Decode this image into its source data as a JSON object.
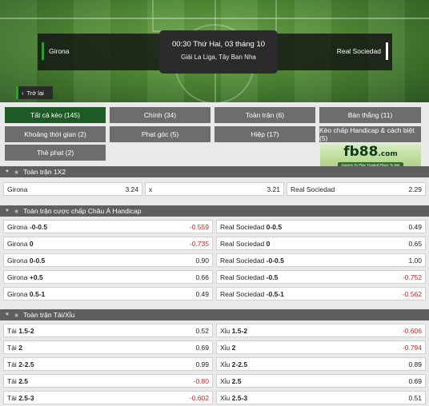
{
  "match": {
    "home": "Girona",
    "away": "Real Sociedad",
    "datetime": "00:30 Thứ Hai, 03 tháng 10",
    "league": "Giải La Liga, Tây Ban Nha",
    "back_label": "Trở lại"
  },
  "filters": [
    {
      "label": "Tất cả kèo (145)",
      "active": true
    },
    {
      "label": "Chính (34)"
    },
    {
      "label": "Toàn trận (6)"
    },
    {
      "label": "Bàn thắng (11)"
    },
    {
      "label": "Khoảng thời gian (2)"
    },
    {
      "label": "Phạt góc (5)"
    },
    {
      "label": "Hiệp (17)"
    },
    {
      "label": "Kèo chấp Handicap & cách biệt (5)"
    },
    {
      "label": "Thẻ phạt (2)"
    }
  ],
  "ad": {
    "logo_main": "fb88",
    "logo_suffix": ".com",
    "tagline": "Games To Play  Trusted Place To Bet"
  },
  "section_1x2": {
    "title": "Toàn trận 1X2",
    "cells": [
      {
        "label": "Girona",
        "value": "3.24"
      },
      {
        "label": "x",
        "value": "3.21"
      },
      {
        "label": "Real Sociedad",
        "value": "2.29"
      }
    ]
  },
  "section_handicap": {
    "title": "Toàn trận cược chấp Châu Á Handicap",
    "rows": [
      {
        "left_team": "Girona",
        "left_line": "-0-0.5",
        "left_value": "-0.559",
        "right_team": "Real Sociedad",
        "right_line": "0-0.5",
        "right_value": "0.49"
      },
      {
        "left_team": "Girona",
        "left_line": "0",
        "left_value": "-0.735",
        "right_team": "Real Sociedad",
        "right_line": "0",
        "right_value": "0.65"
      },
      {
        "left_team": "Girona",
        "left_line": "0-0.5",
        "left_value": "0.90",
        "right_team": "Real Sociedad",
        "right_line": "-0-0.5",
        "right_value": "1.00"
      },
      {
        "left_team": "Girona",
        "left_line": "+0.5",
        "left_value": "0.66",
        "right_team": "Real Sociedad",
        "right_line": "-0.5",
        "right_value": "-0.752"
      },
      {
        "left_team": "Girona",
        "left_line": "0.5-1",
        "left_value": "0.49",
        "right_team": "Real Sociedad",
        "right_line": "-0.5-1",
        "right_value": "-0.562"
      }
    ]
  },
  "section_ou": {
    "title": "Toàn trận Tài/Xỉu",
    "rows": [
      {
        "left_label": "Tài",
        "left_line": "1.5-2",
        "left_value": "0.52",
        "right_label": "Xỉu",
        "right_line": "1.5-2",
        "right_value": "-0.606"
      },
      {
        "left_label": "Tài",
        "left_line": "2",
        "left_value": "0.69",
        "right_label": "Xỉu",
        "right_line": "2",
        "right_value": "-0.794"
      },
      {
        "left_label": "Tài",
        "left_line": "2-2.5",
        "left_value": "0.99",
        "right_label": "Xỉu",
        "right_line": "2-2.5",
        "right_value": "0.89"
      },
      {
        "left_label": "Tài",
        "left_line": "2.5",
        "left_value": "-0.80",
        "right_label": "Xỉu",
        "right_line": "2.5",
        "right_value": "0.69"
      },
      {
        "left_label": "Tài",
        "left_line": "2.5-3",
        "left_value": "-0.602",
        "right_label": "Xỉu",
        "right_line": "2.5-3",
        "right_value": "0.51"
      }
    ]
  },
  "colors": {
    "negative": "#d21f1f",
    "active_filter": "#1f5b27",
    "filter": "#6d6d6d",
    "section_header": "#5f5f5f"
  }
}
